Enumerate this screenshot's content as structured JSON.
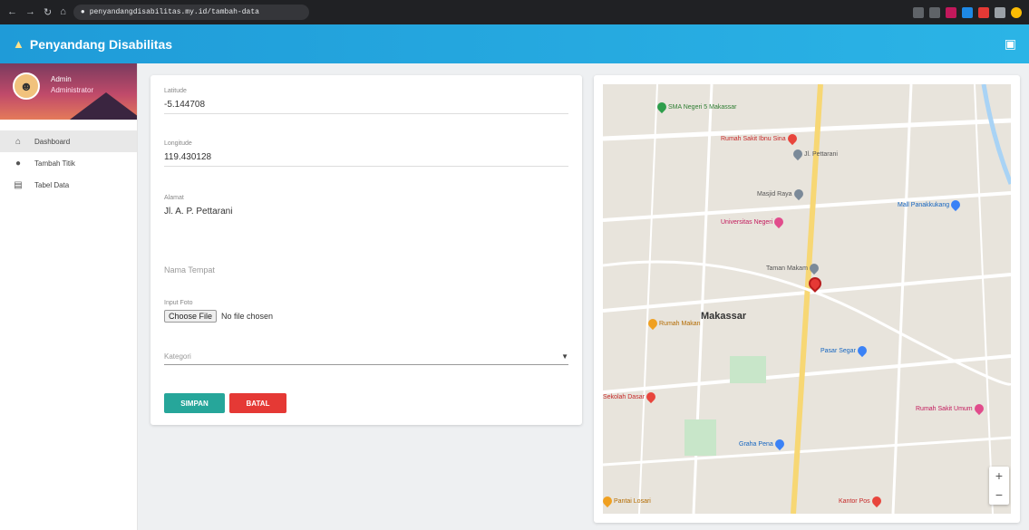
{
  "browser": {
    "nav_icons": [
      "back-icon",
      "forward-icon",
      "reload-icon",
      "home-icon"
    ],
    "lock_icon": "lock-icon",
    "url": "penyandangdisabilitas.my.id/tambah-data"
  },
  "appbar": {
    "title": "Penyandang Disabilitas",
    "logo_icon": "fan-icon",
    "right_icon": "exit-icon",
    "color_start": "#1f9bd8",
    "color_end": "#2bb4e6"
  },
  "sidebar": {
    "user_name": "Admin",
    "user_role": "Administrator",
    "items": [
      {
        "label": "Dashboard",
        "icon": "home-icon"
      },
      {
        "label": "Tambah Titik",
        "icon": "location-pin-icon"
      },
      {
        "label": "Tabel Data",
        "icon": "table-icon"
      }
    ]
  },
  "form": {
    "latitude_label": "Latitude",
    "latitude_value": "-5.144708",
    "longitude_label": "Longitude",
    "longitude_value": "119.430128",
    "address_label": "Alamat",
    "address_value": "Jl. A. P. Pettarani",
    "name_placeholder": "Nama Tempat",
    "photo_label": "Input Foto",
    "file_button": "Choose File",
    "file_note": "No file chosen",
    "category_placeholder": "Kategori",
    "save_label": "SIMPAN",
    "cancel_label": "BATAL"
  },
  "map": {
    "city_label": "Makassar",
    "pois": [
      {
        "name": "SMA Negeri 5 Makassar",
        "color": "green"
      },
      {
        "name": "Rumah Sakit Ibnu Sina",
        "color": "red"
      },
      {
        "name": "Jl. Pettarani",
        "color": "grey"
      },
      {
        "name": "Masjid Raya",
        "color": "grey"
      },
      {
        "name": "Mall Panakkukang",
        "color": "blue"
      },
      {
        "name": "Universitas Negeri",
        "color": "pink"
      },
      {
        "name": "Taman Makam",
        "color": "grey"
      },
      {
        "name": "Rumah Makan",
        "color": "orange"
      },
      {
        "name": "Pasar Segar",
        "color": "blue"
      },
      {
        "name": "Sekolah Dasar",
        "color": "red"
      },
      {
        "name": "Rumah Sakit Umum",
        "color": "pink"
      },
      {
        "name": "Graha Pena",
        "color": "blue"
      },
      {
        "name": "Pantai Losari",
        "color": "orange"
      },
      {
        "name": "Kantor Pos",
        "color": "red"
      }
    ],
    "zoom_in": "+",
    "zoom_out": "−"
  }
}
